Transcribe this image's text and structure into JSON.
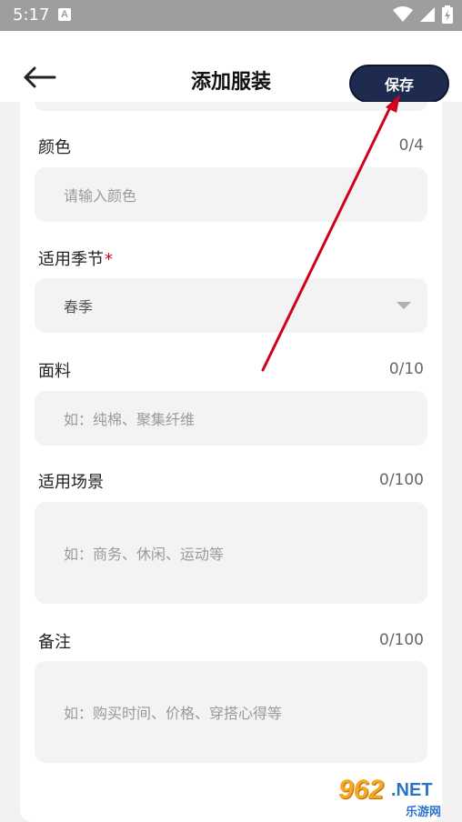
{
  "status_bar": {
    "time": "5:17",
    "notification_icon": "A",
    "icons": [
      "wifi-icon",
      "signal-icon",
      "battery-icon"
    ]
  },
  "header": {
    "back_icon": "arrow-left-icon",
    "title": "添加服装",
    "save_label": "保存"
  },
  "form": {
    "color": {
      "label": "颜色",
      "counter": "0/4",
      "placeholder": "请输入颜色"
    },
    "season": {
      "label": "适用季节",
      "required_mark": "*",
      "value": "春季",
      "dropdown_icon": "caret-down-icon"
    },
    "fabric": {
      "label": "面料",
      "counter": "0/10",
      "placeholder": "如：纯棉、聚集纤维"
    },
    "scene": {
      "label": "适用场景",
      "counter": "0/100",
      "placeholder": "如：商务、休闲、运动等"
    },
    "notes": {
      "label": "备注",
      "counter": "0/100",
      "placeholder": "如：购买时间、价格、穿搭心得等"
    }
  },
  "watermark": {
    "brand": "962",
    "suffix": ".NET",
    "sub": "乐游网"
  },
  "colors": {
    "save_button": "#1f2a4f",
    "required": "#d0021b",
    "annotation_arrow": "#d0021b",
    "field_bg": "#f3f3f3"
  }
}
